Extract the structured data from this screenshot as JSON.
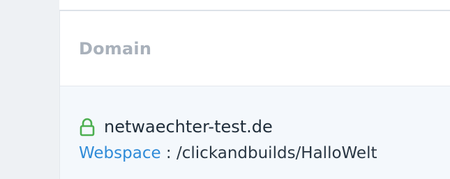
{
  "table": {
    "column_header": "Domain"
  },
  "row": {
    "domain": "netwaechter-test.de",
    "webspace_label": "Webspace",
    "separator": " : ",
    "webspace_path": "/clickandbuilds/HalloWelt",
    "lock_icon": "lock-icon",
    "lock_color": "#4caf50",
    "link_color": "#2f8bd8"
  }
}
